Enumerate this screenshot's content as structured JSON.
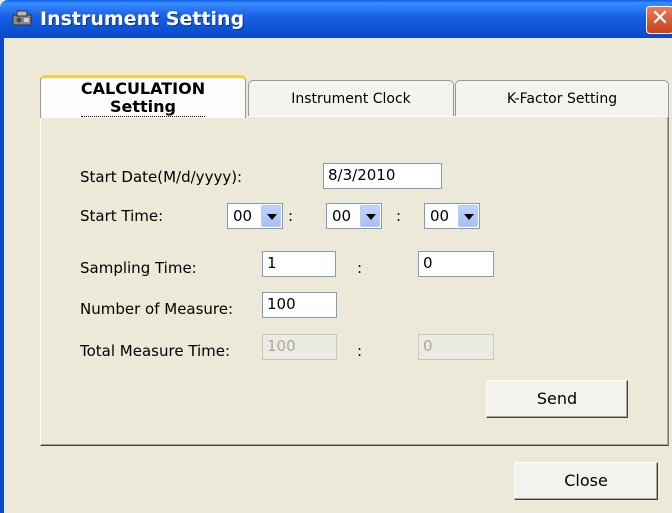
{
  "window": {
    "title": "Instrument Setting",
    "close_glyph": "✕"
  },
  "tabs": [
    {
      "label": "CALCULATION\nSetting",
      "active": true
    },
    {
      "label": "Instrument Clock",
      "active": false
    },
    {
      "label": "K-Factor Setting",
      "active": false
    }
  ],
  "form": {
    "start_date_label": "Start Date(M/d/yyyy):",
    "start_date_value": "8/3/2010",
    "start_time_label": "Start Time:",
    "start_time_hour": "00",
    "start_time_minute": "00",
    "start_time_second": "00",
    "time_separator": ":",
    "sampling_time_label": "Sampling Time:",
    "sampling_time_a": "1",
    "sampling_time_b": "0",
    "number_of_measure_label": "Number of Measure:",
    "number_of_measure_value": "100",
    "total_measure_time_label": "Total Measure Time:",
    "total_measure_time_a": "100",
    "total_measure_time_b": "0"
  },
  "buttons": {
    "send": "Send",
    "close": "Close"
  },
  "icons": {
    "window_icon": "instrument-icon",
    "dropdown": "chevron-down-icon"
  }
}
